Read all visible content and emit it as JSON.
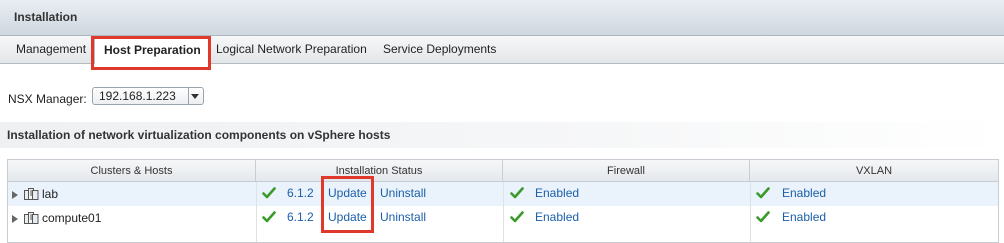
{
  "panel": {
    "title": "Installation"
  },
  "tabs": [
    {
      "label": "Management"
    },
    {
      "label": "Host Preparation"
    },
    {
      "label": "Logical Network Preparation"
    },
    {
      "label": "Service Deployments"
    }
  ],
  "nsx_manager": {
    "label": "NSX Manager:",
    "selected": "192.168.1.223"
  },
  "section": {
    "title": "Installation of network virtualization components on vSphere hosts"
  },
  "table": {
    "columns": [
      "Clusters & Hosts",
      "Installation Status",
      "Firewall",
      "VXLAN"
    ],
    "rows": [
      {
        "name": "lab",
        "version": "6.1.2",
        "update": "Update",
        "uninstall": "Uninstall",
        "firewall": "Enabled",
        "vxlan": "Enabled"
      },
      {
        "name": "compute01",
        "version": "6.1.2",
        "update": "Update",
        "uninstall": "Uninstall",
        "firewall": "Enabled",
        "vxlan": "Enabled"
      }
    ]
  },
  "colors": {
    "highlight": "#e0392b",
    "link": "#1b5fa8",
    "check": "#3a9a2a",
    "selected_row": "#eaf2fb"
  }
}
